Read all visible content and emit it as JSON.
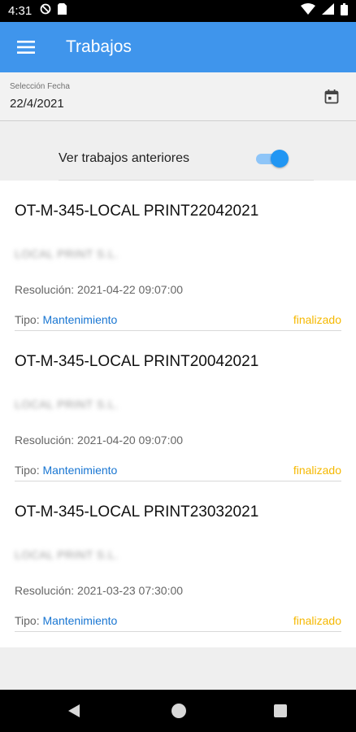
{
  "status_bar": {
    "time": "4:31",
    "icons": [
      "no-disturb-icon",
      "sim-card-icon",
      "wifi-icon",
      "signal-icon",
      "battery-icon"
    ]
  },
  "app_bar": {
    "title": "Trabajos",
    "background": "#3f95ec",
    "menu_icon": "hamburger-menu-icon"
  },
  "date_field": {
    "label": "Selección Fecha",
    "value": "22/4/2021",
    "icon": "calendar-icon"
  },
  "toggle": {
    "label": "Ver trabajos anteriores",
    "checked": true,
    "accent": "#2196f3"
  },
  "jobs": [
    {
      "title": "OT-M-345-LOCAL PRINT22042021",
      "client": "LOCAL PRINT S.L.",
      "resolution": "Resolución: 2021-04-22 09:07:00",
      "tipo_label": "Tipo:",
      "tipo_value": "Mantenimiento",
      "status": "finalizado"
    },
    {
      "title": "OT-M-345-LOCAL PRINT20042021",
      "client": "LOCAL PRINT S.L.",
      "resolution": "Resolución: 2021-04-20 09:07:00",
      "tipo_label": "Tipo:",
      "tipo_value": "Mantenimiento",
      "status": "finalizado"
    },
    {
      "title": "OT-M-345-LOCAL PRINT23032021",
      "client": "LOCAL PRINT S.L.",
      "resolution": "Resolución: 2021-03-23 07:30:00",
      "tipo_label": "Tipo:",
      "tipo_value": "Mantenimiento",
      "status": "finalizado"
    }
  ],
  "colors": {
    "status_finalizado": "#f5b800",
    "tipo_link": "#1976d2"
  },
  "nav_bar": {
    "icons": [
      "back-icon",
      "home-icon",
      "recent-apps-icon"
    ]
  }
}
